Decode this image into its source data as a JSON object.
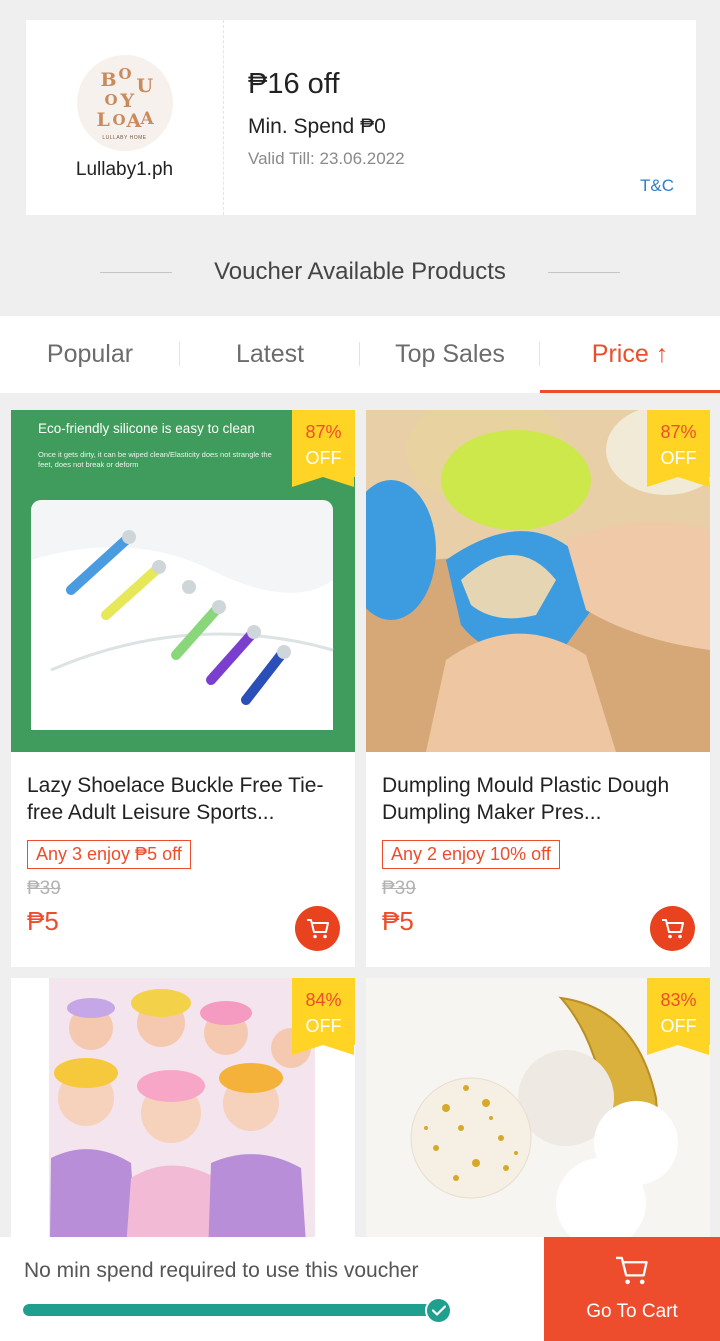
{
  "voucher": {
    "shop_name": "Lullaby1.ph",
    "logo_text": "LULLABY HOME",
    "amount": "₱16 off",
    "min_spend": "Min. Spend ₱0",
    "valid_till": "Valid Till: 23.06.2022",
    "tc_label": "T&C"
  },
  "section_title": "Voucher Available Products",
  "sort_tabs": [
    {
      "label": "Popular",
      "active": false
    },
    {
      "label": "Latest",
      "active": false
    },
    {
      "label": "Top Sales",
      "active": false
    },
    {
      "label": "Price ↑",
      "active": true
    }
  ],
  "products": [
    {
      "title": "Lazy Shoelace Buckle Free Tie-free Adult Leisure Sports...",
      "discount_pct": "87%",
      "discount_off": "OFF",
      "promo": "Any 3 enjoy ₱5 off",
      "original_price": "₱39",
      "price": "₱5",
      "image_banner": "Eco-friendly silicone is easy to clean",
      "image_subtext": "Once it gets dirty, it can be wiped clean/Elasticity does not strangle the feet, does not break or deform"
    },
    {
      "title": "Dumpling Mould Plastic Dough Dumpling Maker Pres...",
      "discount_pct": "87%",
      "discount_off": "OFF",
      "promo": "Any 2 enjoy 10% off",
      "original_price": "₱39",
      "price": "₱5"
    },
    {
      "discount_pct": "84%",
      "discount_off": "OFF"
    },
    {
      "discount_pct": "83%",
      "discount_off": "OFF"
    }
  ],
  "bottom_bar": {
    "message": "No min spend required to use this voucher",
    "progress": 1.0,
    "go_to_cart_label": "Go To Cart"
  },
  "colors": {
    "accent": "#ee4d2d",
    "discount_badge": "#ffd424",
    "progress": "#1f9f8d",
    "link": "#2f7fc6"
  },
  "icons": [
    "cart-icon",
    "check-icon",
    "arrow-up-icon"
  ]
}
